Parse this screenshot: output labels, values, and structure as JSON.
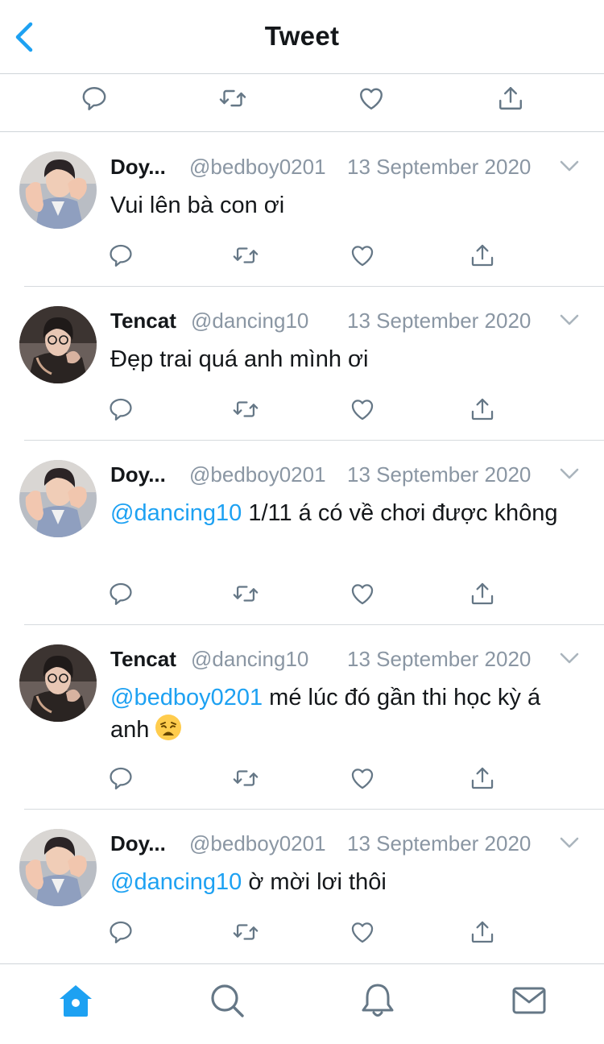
{
  "header": {
    "title": "Tweet",
    "back": "chevron-left-icon"
  },
  "main_actions": [
    "reply-icon",
    "retweet-icon",
    "like-icon",
    "share-icon"
  ],
  "colors": {
    "accent": "#1da1f2",
    "muted": "#8a96a3",
    "text": "#14171a",
    "divider": "#cfd4d9"
  },
  "replies": [
    {
      "name": "Doy...",
      "handle": "@bedboy0201",
      "date": "13 September 2020",
      "mention": "",
      "text": "Vui lên bà con ơi",
      "avatar": "avatar-doy"
    },
    {
      "name": "Tencat",
      "handle": "@dancing10",
      "date": "13 September 2020",
      "mention": "",
      "text": "Đẹp trai quá anh mình ơi",
      "avatar": "avatar-tencat"
    },
    {
      "name": "Doy...",
      "handle": "@bedboy0201",
      "date": "13 September 2020",
      "mention": "@dancing10",
      "text": " 1/11 á có về chơi được không",
      "avatar": "avatar-doy"
    },
    {
      "name": "Tencat",
      "handle": "@dancing10",
      "date": "13 September 2020",
      "mention": "@bedboy0201",
      "text": " mé lúc đó gần thi học kỳ á anh",
      "emoji": "weary-face-emoji",
      "avatar": "avatar-tencat"
    },
    {
      "name": "Doy...",
      "handle": "@bedboy0201",
      "date": "13 September 2020",
      "mention": "@dancing10",
      "text": " ờ mời lơi thôi",
      "avatar": "avatar-doy"
    }
  ],
  "tabbar": [
    {
      "icon": "home-icon",
      "active": true
    },
    {
      "icon": "search-icon",
      "active": false
    },
    {
      "icon": "bell-icon",
      "active": false
    },
    {
      "icon": "mail-icon",
      "active": false
    }
  ]
}
